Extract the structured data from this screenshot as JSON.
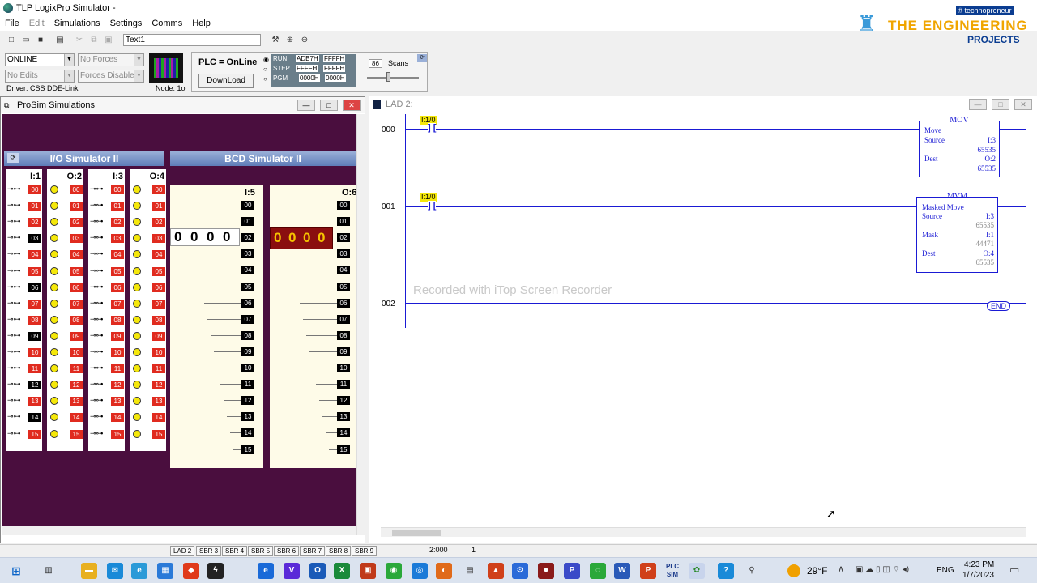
{
  "app": {
    "title": "TLP LogixPro Simulator  -"
  },
  "menu": [
    "File",
    "Edit",
    "Simulations",
    "Settings",
    "Comms",
    "Help"
  ],
  "toolbar": {
    "text_field": "Text1"
  },
  "ctl": {
    "mode": "ONLINE",
    "forces": "No Forces",
    "edits": "No Edits",
    "forces_disabled": "Forces Disabled",
    "driver": "Driver: CSS DDE-Link",
    "node": "Node: 1o",
    "plc_status": "PLC = OnLine",
    "download": "DownLoad",
    "run": "RUN",
    "step": "STEP",
    "pgm": "PGM",
    "hex1": "ADB7H",
    "hex2": "FFFFH",
    "hex3": "FFFFH",
    "hex4": "FFFFH",
    "hex5": "0000H",
    "hex6": "0000H",
    "scans_value": "86",
    "scans_label": "Scans"
  },
  "prosim": {
    "title": "ProSim Simulations",
    "io_header": "I/O Simulator II",
    "bcd_header": "BCD Simulator II",
    "cols": [
      "I:1",
      "O:2",
      "I:3",
      "O:4"
    ],
    "bcd_cols": [
      "I:5",
      "O:6"
    ],
    "bits": [
      "00",
      "01",
      "02",
      "03",
      "04",
      "05",
      "06",
      "07",
      "08",
      "09",
      "10",
      "11",
      "12",
      "13",
      "14",
      "15"
    ],
    "i1_on": [
      "03",
      "06",
      "09",
      "12",
      "14"
    ],
    "bcd_in_digits": [
      "0",
      "0",
      "0",
      "0"
    ],
    "bcd_out_digits": [
      "0",
      "0",
      "0",
      "0"
    ]
  },
  "lad": {
    "title": "LAD 2:",
    "rungs": [
      "000",
      "001",
      "002"
    ],
    "contact1": "I:1/0",
    "contact2": "I:1/0",
    "mov": {
      "name": "MOV",
      "op": "Move",
      "src_lbl": "Source",
      "src": "I:3",
      "src_val": "65535",
      "dst_lbl": "Dest",
      "dst": "O:2",
      "dst_val": "65535"
    },
    "mvm": {
      "name": "MVM",
      "op": "Masked Move",
      "src_lbl": "Source",
      "src": "I:3",
      "src_val": "65535",
      "mask_lbl": "Mask",
      "mask": "I:1",
      "mask_val": "44471",
      "dst_lbl": "Dest",
      "dst": "O:4",
      "dst_val": "65535"
    },
    "end": "END"
  },
  "watermark": "Recorded with iTop Screen Recorder",
  "logo": {
    "tag": "# technopreneur",
    "line1": "THE ENGINEERING",
    "line2": "PROJECTS"
  },
  "status": {
    "tabs": [
      "LAD 2",
      "SBR 3",
      "SBR 4",
      "SBR 5",
      "SBR 6",
      "SBR 7",
      "SBR 8",
      "SBR 9"
    ],
    "addr": "2:000",
    "num": "1"
  },
  "taskbar": {
    "weather": "29°F",
    "lang": "ENG",
    "time": "4:23 PM",
    "date": "1/7/2023",
    "plcsim": "PLC SIM"
  }
}
